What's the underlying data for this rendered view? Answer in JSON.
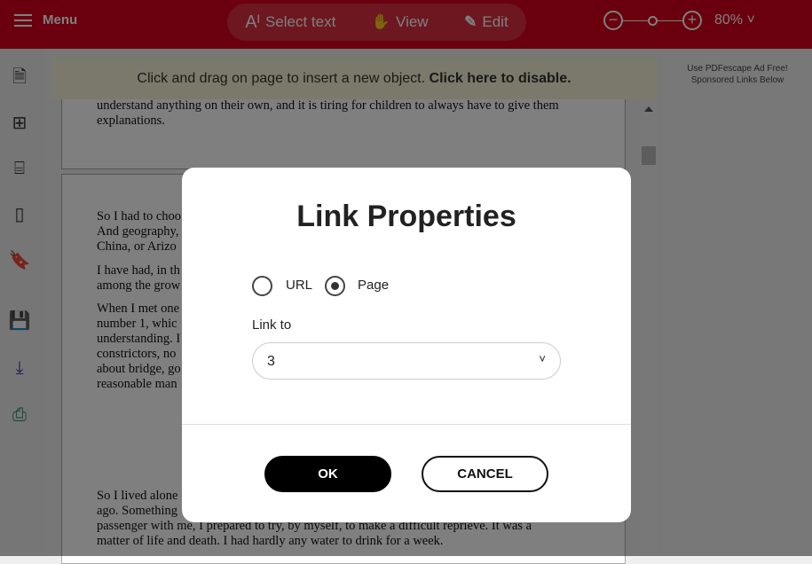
{
  "header": {
    "menu_label": "Menu",
    "modes": [
      "Select text",
      "View",
      "Edit"
    ],
    "zoom_level": "80%"
  },
  "notice": {
    "text": "Click and drag on page to insert a new object. ",
    "link": "Click here to disable."
  },
  "ad": {
    "line1": "Use PDFescape Ad Free!",
    "line2": "Sponsored Links Below"
  },
  "page1": {
    "lines": [
      "understand anything on their own, and it is tiring for children to always have to give them",
      "explanations."
    ]
  },
  "page2": {
    "lines": [
      "So I had to choo",
      "And geography,",
      "China, or Arizo",
      "I have had, in th",
      "among the grow",
      "When I met one",
      "number 1, whic",
      "understanding. I",
      "constrictors, no",
      "about bridge, go",
      "reasonable man",
      "So I lived alone",
      "ago. Something",
      "passenger with me, I prepared to try, by myself, to make a difficult reprieve. It was a",
      "matter of life and death. I had hardly any water to drink for a week."
    ]
  },
  "dialog": {
    "title": "Link Properties",
    "option_url": "URL",
    "option_page": "Page",
    "selected": "Page",
    "link_to_label": "Link to",
    "link_to_value": "3",
    "ok": "OK",
    "cancel": "CANCEL"
  }
}
